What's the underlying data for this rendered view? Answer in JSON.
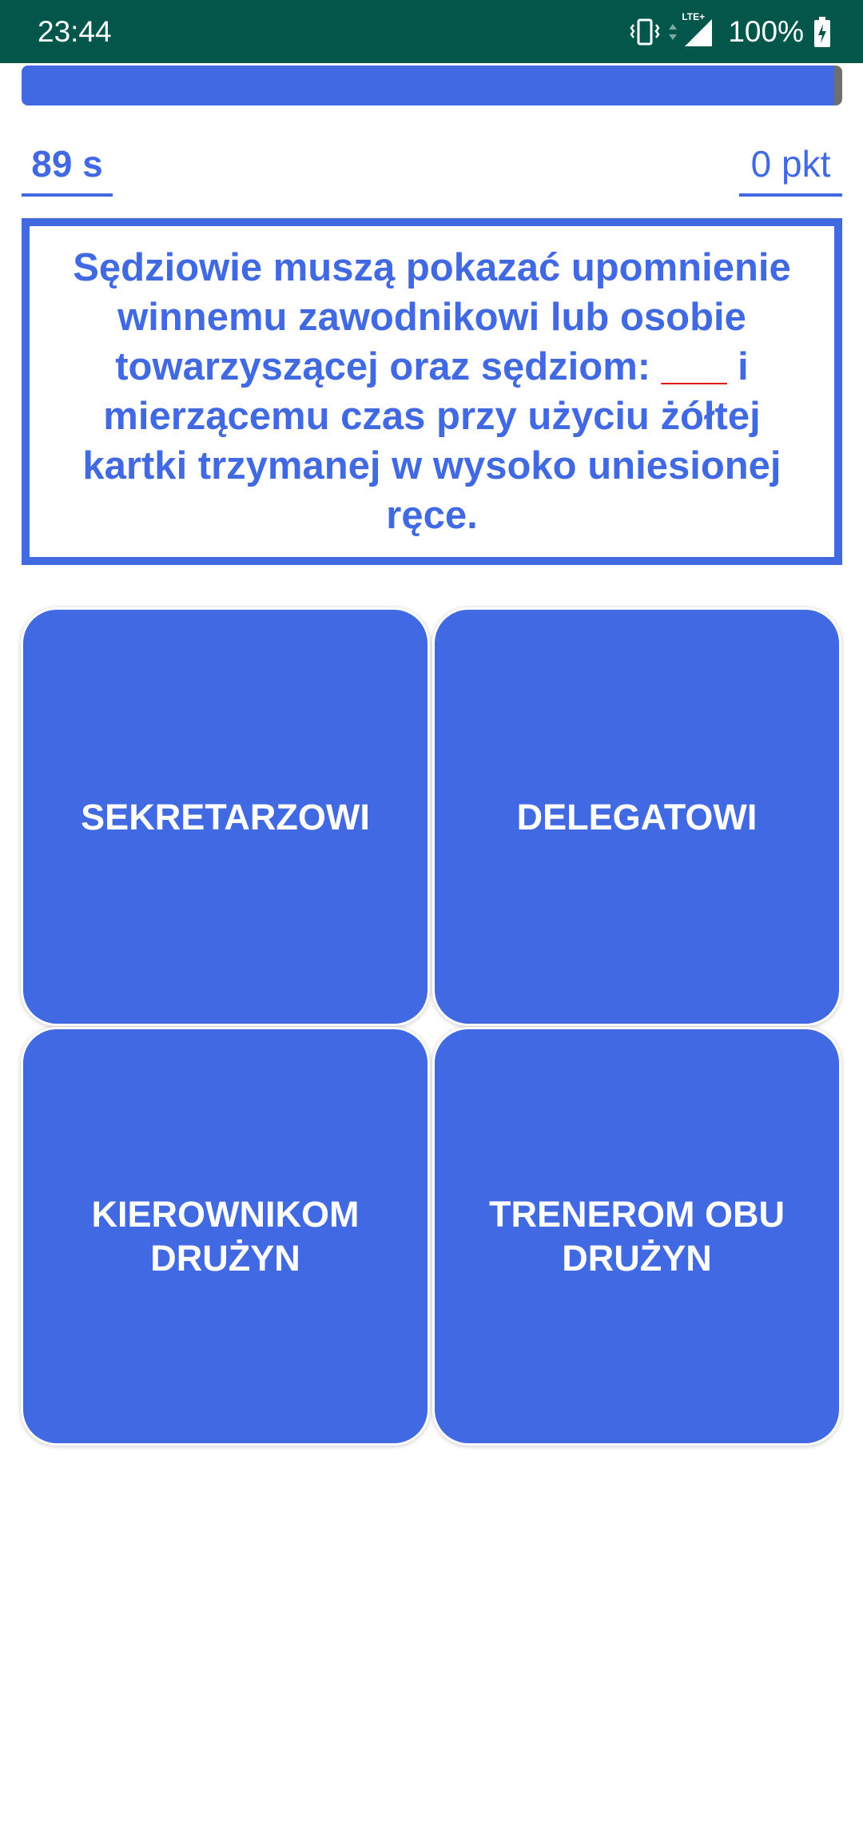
{
  "status_bar": {
    "time": "23:44",
    "network": "LTE+",
    "battery_percent": "100%",
    "icons": [
      "vibrate-icon",
      "data-arrows-icon",
      "signal-icon",
      "battery-charging-icon"
    ]
  },
  "quiz": {
    "time_progress_fraction": 0.99,
    "timer": "89 s",
    "score": "0 pkt",
    "question_parts": {
      "before": "Sędziowie muszą pokazać upomnienie winnemu zawodnikowi lub osobie towarzyszącej oraz sędziom:",
      "blank": "___",
      "after": "i mierzącemu czas przy użyciu żółtej kartki trzymanej w wysoko uniesionej ręce."
    },
    "answers": [
      "SEKRETARZOWI",
      "DELEGATOWI",
      "KIEROWNIKOM DRUŻYN",
      "TRENEROM OBU DRUŻYN"
    ]
  },
  "colors": {
    "status_bar": "#02574a",
    "accent": "#4169e1",
    "blank": "#e00000",
    "background": "#ffffff"
  }
}
